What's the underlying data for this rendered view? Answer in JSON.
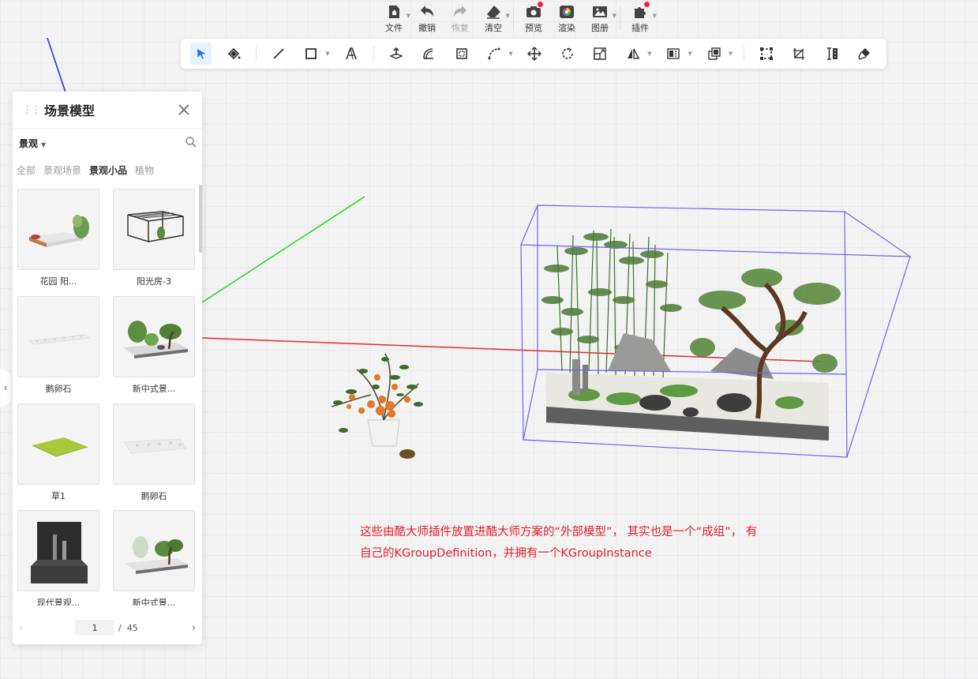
{
  "topbar": {
    "items": [
      {
        "label": "文件",
        "icon": "file-icon",
        "caret": true
      },
      {
        "label": "撤销",
        "icon": "undo-icon"
      },
      {
        "label": "恢复",
        "icon": "redo-icon",
        "disabled": true
      },
      {
        "label": "清空",
        "icon": "eraser-icon",
        "caret": true
      },
      {
        "label": "预览",
        "icon": "camera-icon",
        "badge": true
      },
      {
        "label": "渲染",
        "icon": "render-icon"
      },
      {
        "label": "图册",
        "icon": "gallery-icon",
        "caret": true
      },
      {
        "label": "插件",
        "icon": "plugin-icon",
        "caret": true,
        "badge": true
      }
    ]
  },
  "toolbar": {
    "tools": [
      "select-tool",
      "paint-bucket-tool",
      "line-tool",
      "rectangle-tool",
      "text-3d-tool",
      "push-pull-tool",
      "offset-tool",
      "follow-me-tool",
      "arc-tool",
      "move-tool",
      "rotate-tool",
      "scale-tool",
      "mirror-tool",
      "align-tool",
      "array-tool",
      "group-tool",
      "cut-tool",
      "measure-tool",
      "paint-tool"
    ]
  },
  "panel": {
    "title": "场景模型",
    "category": "景观",
    "tabs": [
      "全部",
      "景观场景",
      "景观小品",
      "植物"
    ],
    "active_tab": "景观小品",
    "items": [
      {
        "name": "花园 阳..."
      },
      {
        "name": "阳光房-3"
      },
      {
        "name": "鹅卵石"
      },
      {
        "name": "新中式景..."
      },
      {
        "name": "草1"
      },
      {
        "name": "鹅卵石"
      },
      {
        "name": "现代景观..."
      },
      {
        "name": "新中式景..."
      }
    ],
    "pager": {
      "current": "1",
      "separator": "/",
      "total": "45"
    }
  },
  "annotation": {
    "line1": "这些由酷大师插件放置进酷大师方案的“外部模型”， 其实也是一个“成组”， 有",
    "line2": "自己的KGroupDefinition，并拥有一个KGroupInstance"
  },
  "colors": {
    "accent": "#1677ff",
    "annotation": "#e0202a",
    "selection_box": "#6b62f0",
    "axis_x": "#e52b2b",
    "axis_y": "#1fd81f",
    "axis_z": "#1a2fd9"
  }
}
